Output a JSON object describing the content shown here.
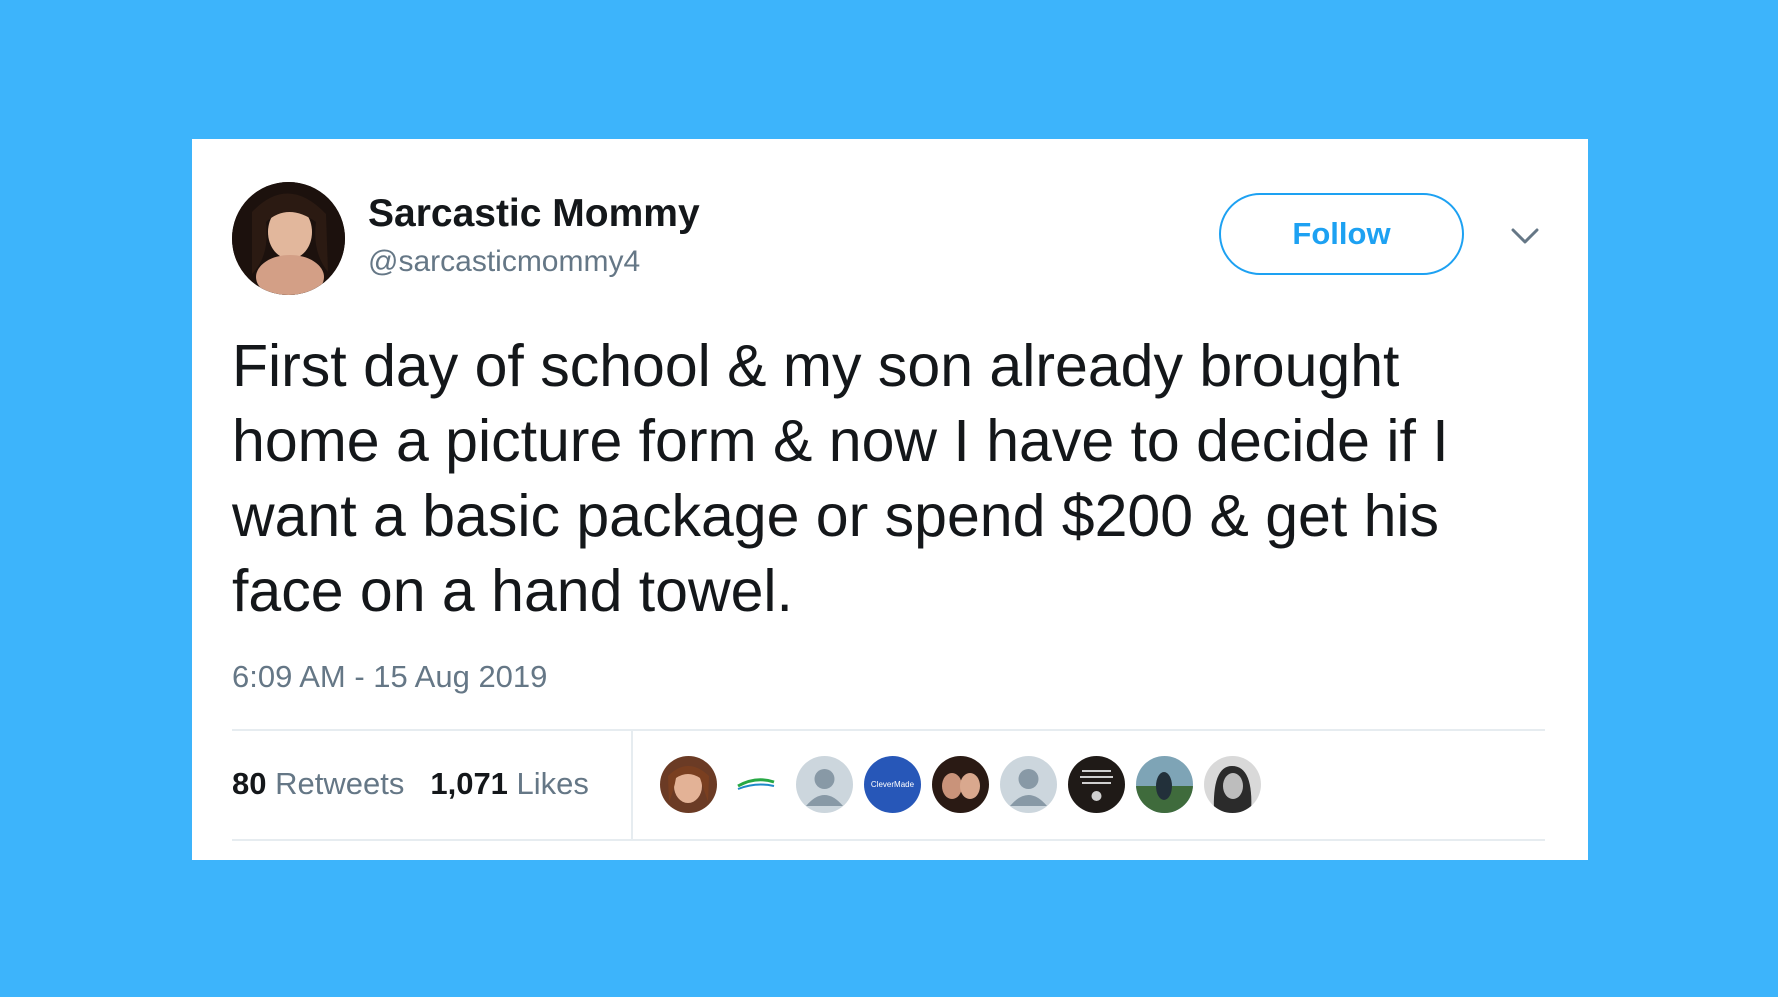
{
  "user": {
    "display_name": "Sarcastic Mommy",
    "handle": "@sarcasticmommy4"
  },
  "follow_label": "Follow",
  "tweet": {
    "text": "First day of school & my son already brought home a picture form & now I have to decide if I want a basic package or spend $200 & get his face on a hand towel.",
    "timestamp": "6:09 AM - 15 Aug 2019"
  },
  "stats": {
    "retweets_count": "80",
    "retweets_label": "Retweets",
    "likes_count": "1,071",
    "likes_label": "Likes"
  },
  "likers": [
    {
      "icon": "profile-photo"
    },
    {
      "icon": "brand-logo"
    },
    {
      "icon": "default-profile"
    },
    {
      "icon": "brand-logo",
      "label": "CleverMade"
    },
    {
      "icon": "profile-photo"
    },
    {
      "icon": "default-profile"
    },
    {
      "icon": "text-logo"
    },
    {
      "icon": "profile-photo"
    },
    {
      "icon": "profile-photo"
    }
  ],
  "colors": {
    "background": "#3db4fb",
    "accent": "#1da1f2",
    "text_primary": "#14171a",
    "text_secondary": "#657786"
  }
}
